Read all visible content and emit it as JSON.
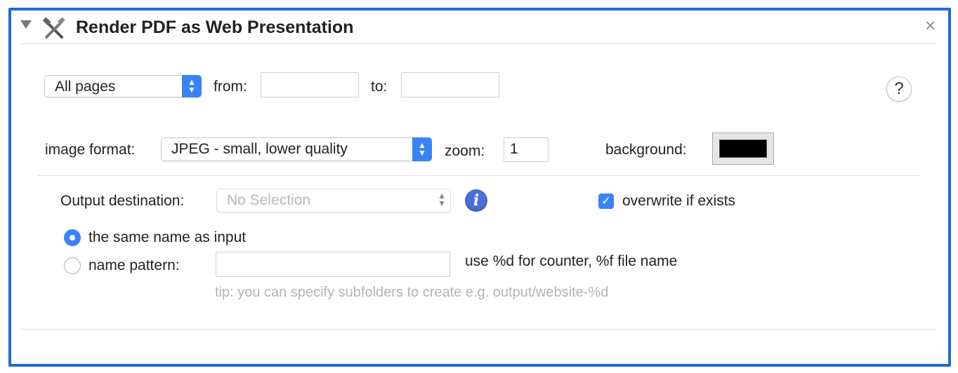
{
  "title": "Render PDF as Web Presentation",
  "icons": {
    "disclosure": "disclosure-triangle-icon",
    "action": "tools-icon",
    "close": "close-icon",
    "help": "help-icon",
    "info": "info-icon"
  },
  "glyphs": {
    "close": "×",
    "help": "?",
    "info": "i",
    "check": "✓",
    "stepper_up": "▲",
    "stepper_down": "▼"
  },
  "pages": {
    "selected": "All pages",
    "from_label": "from:",
    "from_value": "",
    "to_label": "to:",
    "to_value": ""
  },
  "image": {
    "format_label": "image format:",
    "format_selected": "JPEG - small, lower quality",
    "zoom_label": "zoom:",
    "zoom_value": "1",
    "background_label": "background:",
    "background_color": "#000000"
  },
  "output": {
    "destination_label": "Output destination:",
    "destination_selected": "No Selection",
    "overwrite_label": "overwrite if exists",
    "overwrite_checked": true,
    "same_name_label": "the same name as input",
    "same_name_selected": true,
    "pattern_label": "name pattern:",
    "pattern_value": "",
    "pattern_hint": "use %d for counter, %f file name",
    "tip": "tip: you can specify subfolders to create e.g. output/website-%d"
  },
  "colors": {
    "accent": "#3a82f7",
    "frame": "#1f6bd6",
    "info": "#4a6fd6"
  }
}
